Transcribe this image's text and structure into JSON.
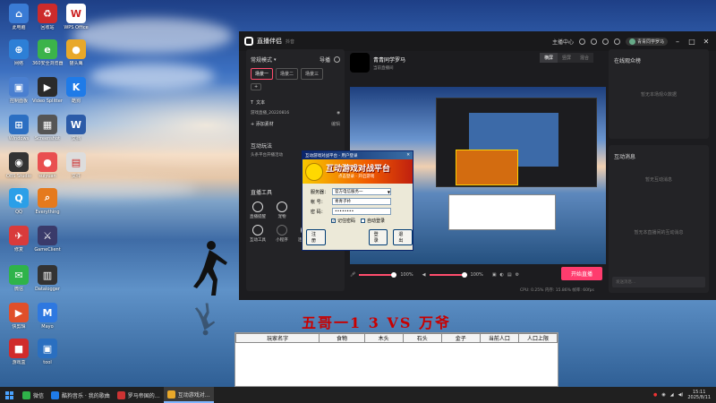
{
  "desktop_icons": [
    {
      "label": "此电脑",
      "color": "#3a7bd5",
      "glyph": "⌂"
    },
    {
      "label": "回收站",
      "color": "#cc2b2b",
      "glyph": "♻"
    },
    {
      "label": "WPS Office",
      "color": "#ffffff",
      "glyph": "W"
    },
    {
      "label": "网络",
      "color": "#2d7fd6",
      "glyph": "⊕"
    },
    {
      "label": "360安全浏览器",
      "color": "#3bb34a",
      "glyph": "e"
    },
    {
      "label": "猫头鹰",
      "color": "#e8a82a",
      "glyph": "●"
    },
    {
      "label": "控制面板",
      "color": "#4a7fd0",
      "glyph": "▣"
    },
    {
      "label": "Video Splitter",
      "color": "#2a2a2a",
      "glyph": "▶"
    },
    {
      "label": "酷狗",
      "color": "#1f7be8",
      "glyph": "K"
    },
    {
      "label": "Windows",
      "color": "#2c6fc2",
      "glyph": "⊞"
    },
    {
      "label": "Screenshot",
      "color": "#555555",
      "glyph": "▦"
    },
    {
      "label": "文档",
      "color": "#2b5ba8",
      "glyph": "W"
    },
    {
      "label": "OBS Studio",
      "color": "#333333",
      "glyph": "◉"
    },
    {
      "label": "suiyuan",
      "color": "#e94f4f",
      "glyph": "●"
    },
    {
      "label": "文件",
      "color": "#dddddd",
      "glyph": "▤"
    },
    {
      "label": "QQ",
      "color": "#2b9fe8",
      "glyph": "Q"
    },
    {
      "label": "Everything",
      "color": "#e57a1d",
      "glyph": "⌕"
    },
    {
      "label": "修复",
      "color": "#d93b3b",
      "glyph": "✈"
    },
    {
      "label": "GameClient",
      "color": "#3a3a6a",
      "glyph": "⚔"
    },
    {
      "label": "微信",
      "color": "#2fb34a",
      "glyph": "✉"
    },
    {
      "label": "Datalogger",
      "color": "#333333",
      "glyph": "▥"
    },
    {
      "label": "快剪辑",
      "color": "#e04f2a",
      "glyph": "▶"
    },
    {
      "label": "Mayo",
      "color": "#2e78e0",
      "glyph": "M"
    },
    {
      "label": "游戏盒",
      "color": "#d02b2b",
      "glyph": "■"
    },
    {
      "label": "tool",
      "color": "#2a6fc0",
      "glyph": "▣"
    }
  ],
  "app": {
    "title": "直播伴侣",
    "subtitle": "抖音",
    "top_right": {
      "upload": "主播中心",
      "user": "青青同学罗马"
    },
    "mode": "常规模式",
    "guide_label": "导播",
    "scenes": [
      "场景一",
      "场景二",
      "场景三"
    ],
    "source_section": "文本",
    "source_item": "游戏直播_20220816",
    "add_material": "添加素材",
    "edit_label": "编辑",
    "interactive_title": "互动玩法",
    "interactive_sub": "头条平台开播活动",
    "tools_title": "直播工具",
    "tools": [
      "直播提醒",
      "宠物",
      "互动工具",
      "小程序",
      "连麦直播",
      "虚拟形象"
    ],
    "preview_streamer": "青青同学罗马",
    "preview_tag": "当前直播间",
    "preview_toggle": [
      "横屏",
      "竖屏",
      "混合"
    ],
    "mic_level": "100%",
    "speaker_level": "100%",
    "start_live": "开始直播",
    "status": "CPU: 0.25%  内存: 15.86%  帧率: 60fps",
    "audience_title": "在线观众榜",
    "audience_empty": "暂无本场观众数据",
    "messages_title": "互动消息",
    "messages_empty": "暂无互动消息",
    "messages_empty2": "暂无本直播间的互动消息",
    "input_placeholder": "发送消息..."
  },
  "login": {
    "window_title": "互动游戏对战平台 - 用户登录",
    "banner_title": "互动游戏对战平台",
    "banner_sub": "点击登录 · 开启游戏",
    "server_label": "服务器：",
    "server_value": "官方电信服务一",
    "account_label": "帐  号：",
    "account_value": "青青子衿",
    "password_label": "密  码：",
    "password_value": "••••••••",
    "remember_label": "记住密码",
    "auto_label": "自动登录",
    "register_button": "注册",
    "login_button": "登录",
    "exit_button": "退出"
  },
  "game_title": "五哥一1 3 VS 万爷",
  "table": {
    "headers": [
      "玩家名字",
      "食物",
      "木头",
      "石头",
      "金子",
      "当前人口",
      "人口上限"
    ]
  },
  "taskbar": {
    "items": [
      {
        "label": "微信",
        "color": "#2fb34a"
      },
      {
        "label": "酷狗音乐 · 我的歌曲",
        "color": "#1f7be8"
      },
      {
        "label": "罗马帝国的…",
        "color": "#cc3333"
      },
      {
        "label": "互动游戏对…",
        "color": "#e8a82a"
      }
    ],
    "time": "15:11",
    "date": "2025/8/11"
  }
}
